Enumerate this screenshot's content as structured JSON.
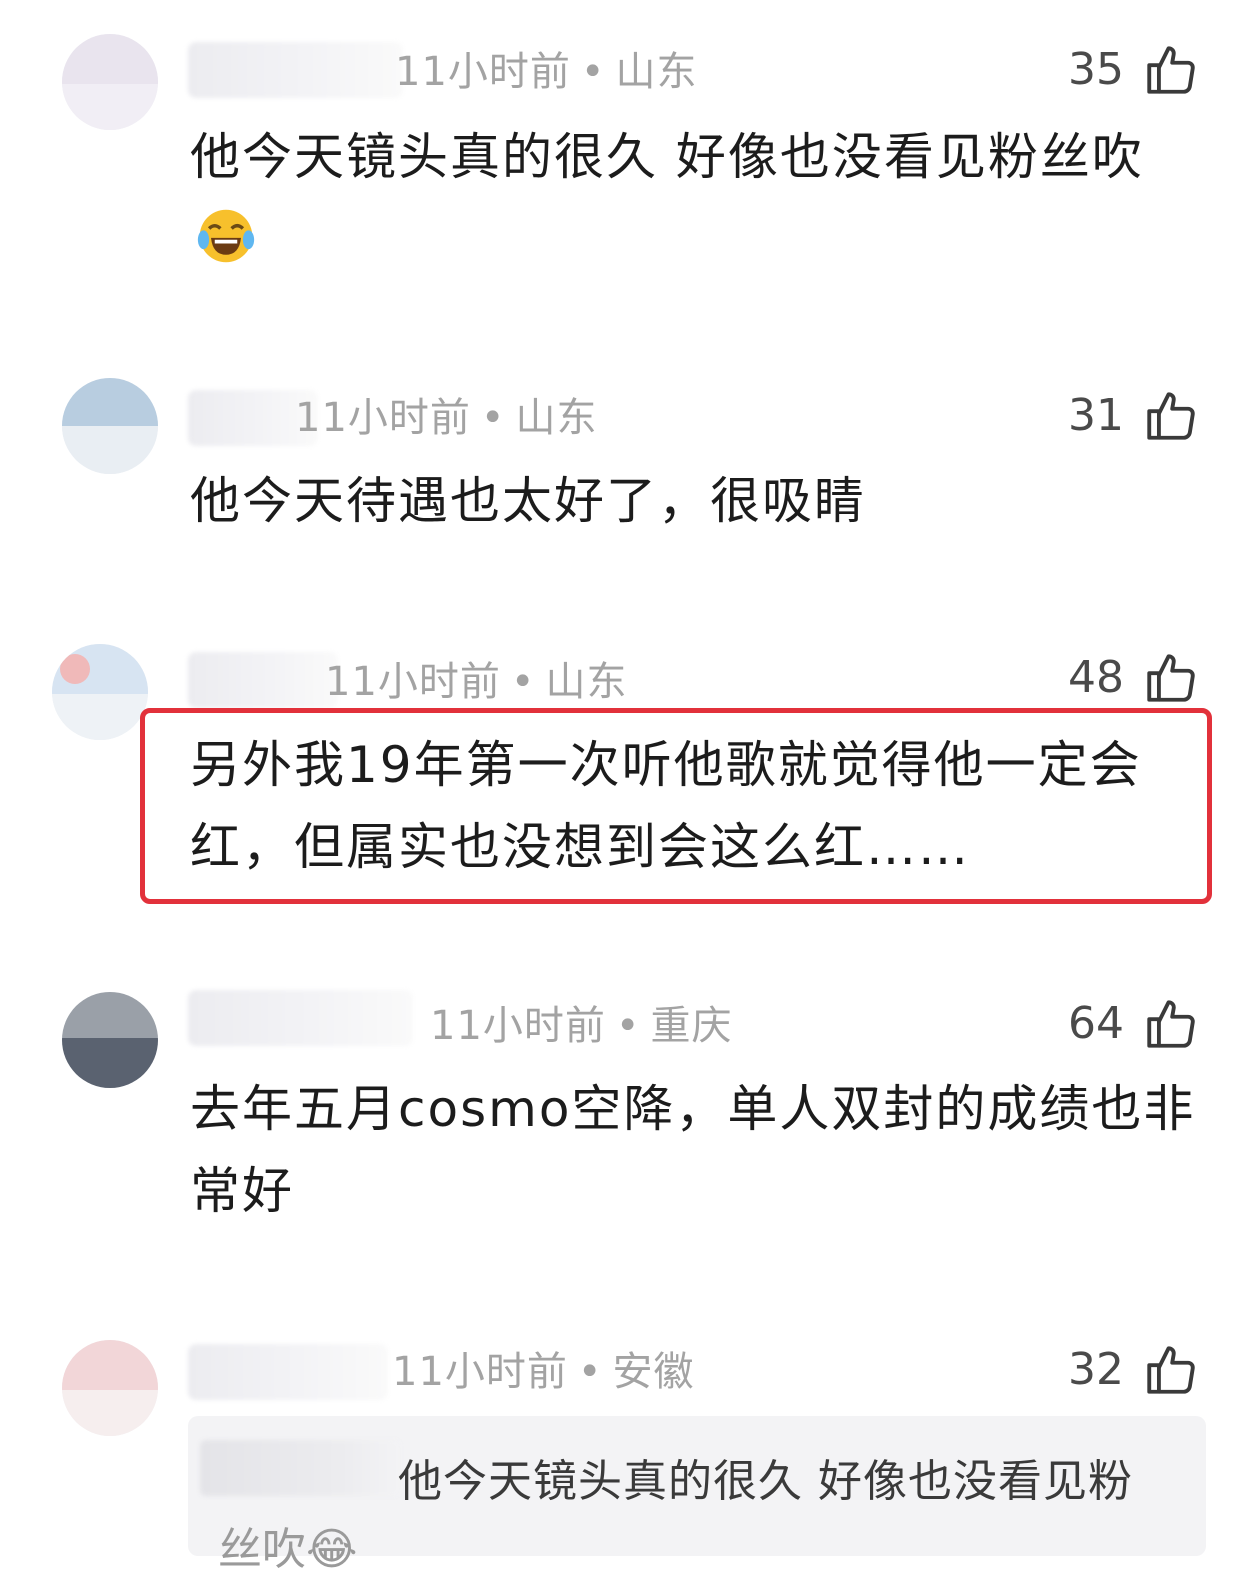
{
  "colors": {
    "highlight_border": "#e2313b",
    "meta_text": "#a3a3a3",
    "body_text": "#1c1c1c"
  },
  "comments": [
    {
      "time": "11小时前",
      "location": "山东",
      "likes": "35",
      "text": "他今天镜头真的很久 好像也没看见粉丝吹",
      "emoji": "laughing-tears-emoji"
    },
    {
      "time": "11小时前",
      "location": "山东",
      "likes": "31",
      "text": "他今天待遇也太好了，很吸睛"
    },
    {
      "time": "11小时前",
      "location": "山东",
      "likes": "48",
      "text": "另外我19年第一次听他歌就觉得他一定会红，但属实也没想到会这么红……",
      "highlighted": true
    },
    {
      "time": "11小时前",
      "location": "重庆",
      "likes": "64",
      "text": "去年五月cosmo空降，单人双封的成绩也非常好"
    },
    {
      "time": "11小时前",
      "location": "安徽",
      "likes": "32",
      "reply_quote": "他今天镜头真的很久 好像也没看见粉",
      "reply_quote_rest": "丝吹😂"
    }
  ]
}
